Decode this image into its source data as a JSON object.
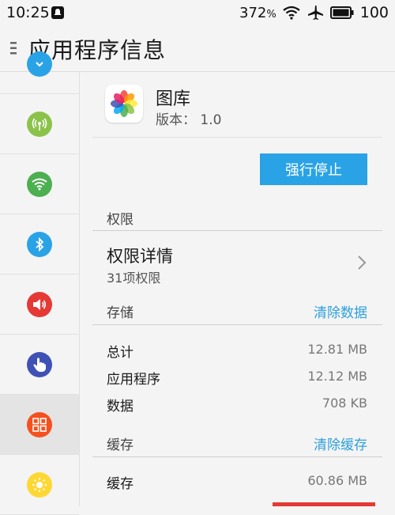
{
  "status_bar": {
    "time": "10:25",
    "speed": "372",
    "speed_unit": "%",
    "battery": "100"
  },
  "title_bar": {
    "title": "应用程序信息"
  },
  "sidebar": {
    "items": [
      {
        "icon": "partial-icon",
        "color": "#2aa3e6"
      },
      {
        "icon": "hotspot-icon",
        "color": "#8bc34a"
      },
      {
        "icon": "wifi-icon",
        "color": "#4caf50"
      },
      {
        "icon": "bluetooth-icon",
        "color": "#2aa3e6"
      },
      {
        "icon": "sound-icon",
        "color": "#e53935"
      },
      {
        "icon": "gesture-icon",
        "color": "#3f51b5"
      },
      {
        "icon": "apps-icon",
        "color": "#f4511e",
        "selected": true
      },
      {
        "icon": "brightness-icon",
        "color": "#fdd835"
      }
    ]
  },
  "app": {
    "name": "图库",
    "version": "版本： 1.0"
  },
  "force_stop_label": "强行停止",
  "permissions": {
    "section": "权限",
    "details_title": "权限详情",
    "details_count": "31项权限"
  },
  "storage": {
    "section": "存储",
    "clear_label": "清除数据",
    "rows": [
      {
        "label": "总计",
        "value": "12.81 MB"
      },
      {
        "label": "应用程序",
        "value": "12.12 MB"
      },
      {
        "label": "数据",
        "value": "708 KB"
      }
    ]
  },
  "cache": {
    "section": "缓存",
    "clear_label": "清除缓存",
    "rows": [
      {
        "label": "缓存",
        "value": "60.86 MB"
      }
    ]
  },
  "colors": {
    "accent": "#2aa3e6",
    "link": "#2ea0dc",
    "danger": "#e53935"
  }
}
